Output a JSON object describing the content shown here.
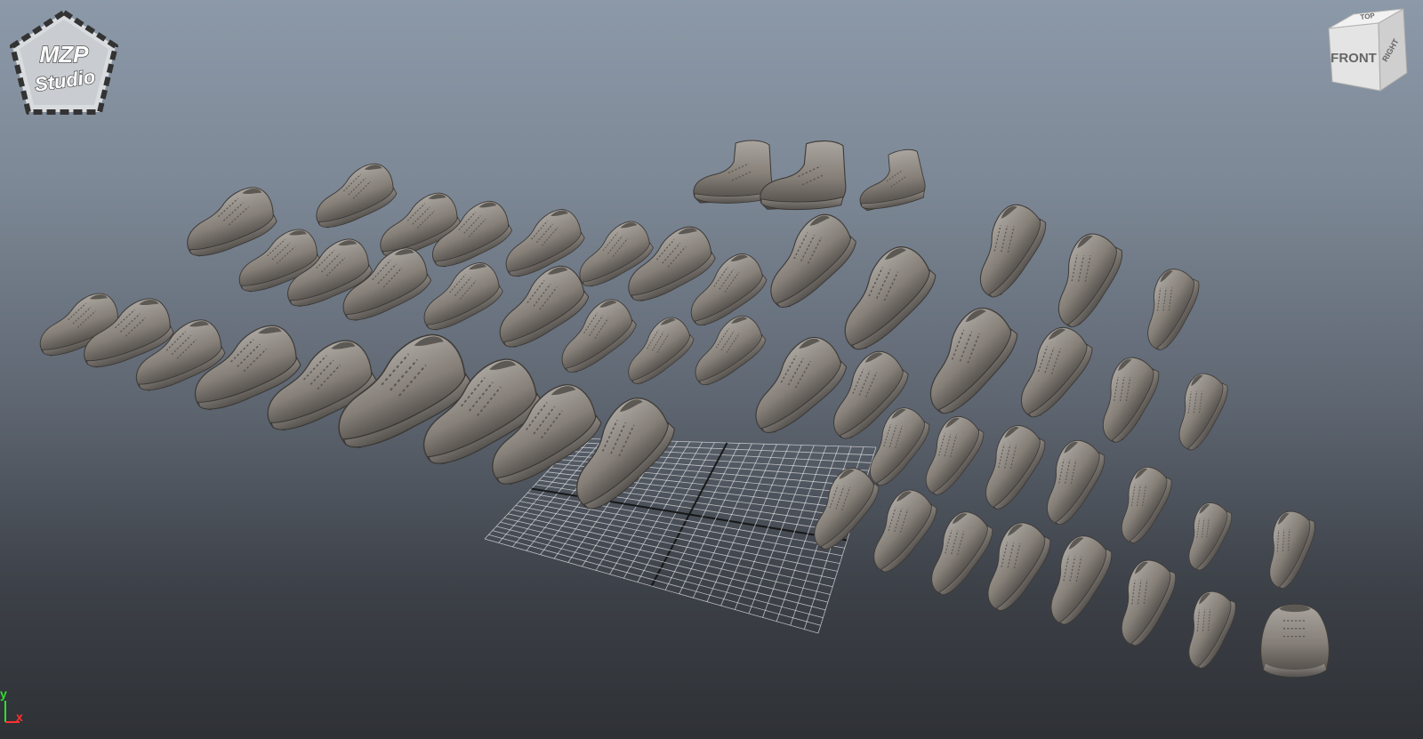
{
  "viewport": {
    "logo": {
      "line1": "MZP",
      "line2": "Studio"
    },
    "view_cube": {
      "front": "FRONT",
      "right": "RIGHT",
      "top": "TOP"
    },
    "axis": {
      "y": "y",
      "x": "x"
    },
    "colors": {
      "shoe": "#8a8580",
      "grid": "#e6e6e6",
      "grid_axis": "#111111",
      "axis_x": "#ff3030",
      "axis_y": "#2ee02e"
    }
  }
}
